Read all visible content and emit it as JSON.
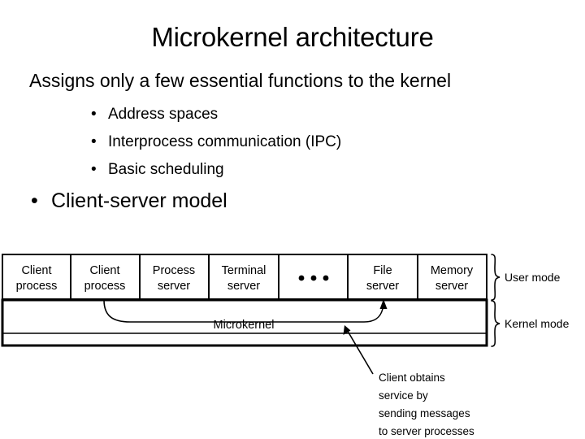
{
  "slide": {
    "title": "Microkernel architecture",
    "lead": "Assigns only a few essential functions to the kernel",
    "bullet_marker": "•",
    "sub_bullets": [
      "Address spaces",
      "Interprocess communication (IPC)",
      "Basic scheduling"
    ],
    "main_bullet": "Client-server model"
  },
  "figure": {
    "user_row": [
      {
        "line1": "Client",
        "line2": "process"
      },
      {
        "line1": "Client",
        "line2": "process"
      },
      {
        "line1": "Process",
        "line2": "server"
      },
      {
        "line1": "Terminal",
        "line2": "server"
      },
      {
        "line1": "• • •",
        "line2": ""
      },
      {
        "line1": "File",
        "line2": "server"
      },
      {
        "line1": "Memory",
        "line2": "server"
      }
    ],
    "kernel_label": "Microkernel",
    "brace_labels": {
      "user": "User mode",
      "kernel": "Kernel mode"
    },
    "caption_lines": [
      "Client obtains",
      "service by",
      "sending messages",
      "to server processes"
    ],
    "colors": {
      "ink": "#000000",
      "paper": "#ffffff"
    }
  }
}
